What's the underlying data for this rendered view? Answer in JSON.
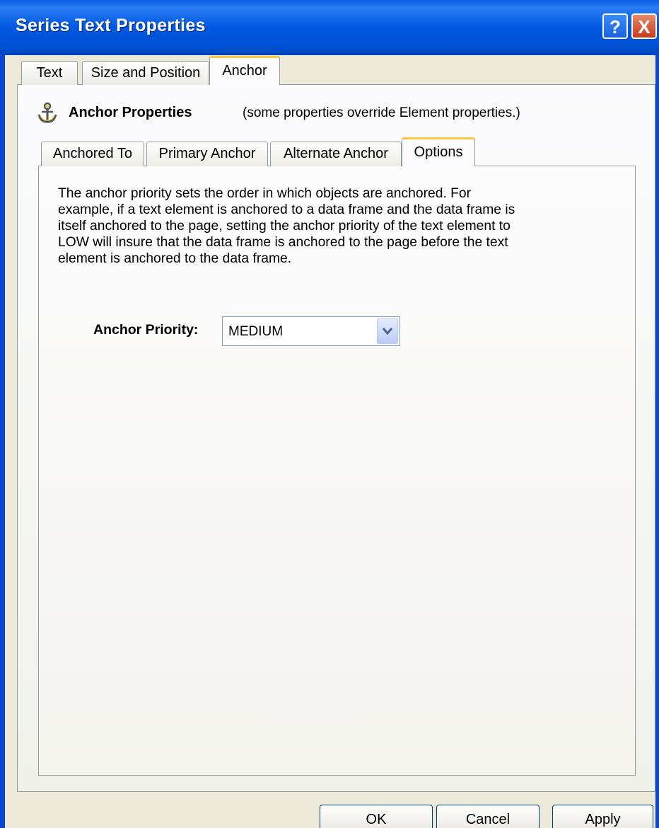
{
  "window": {
    "title": "Series Text Properties"
  },
  "title_buttons": {
    "help": "?",
    "close": "X"
  },
  "tabs": [
    {
      "label": "Text",
      "active": false
    },
    {
      "label": "Size and Position",
      "active": false
    },
    {
      "label": "Anchor",
      "active": true
    }
  ],
  "anchor_section": {
    "icon": "anchor-icon",
    "title": "Anchor Properties",
    "note": "(some properties override Element properties.)"
  },
  "subtabs": [
    {
      "label": "Anchored To",
      "active": false
    },
    {
      "label": "Primary Anchor",
      "active": false
    },
    {
      "label": "Alternate Anchor",
      "active": false
    },
    {
      "label": "Options",
      "active": true
    }
  ],
  "options": {
    "description_lines": [
      "The anchor priority sets the order in which objects are anchored.  For",
      "example, if a text element is anchored to a data frame and the data frame is",
      "itself anchored to the page, setting the anchor priority of the text element to",
      "LOW will insure that the data frame is anchored to the page before the text",
      "element is anchored to the data frame."
    ],
    "priority_label": "Anchor Priority:",
    "priority_value": "MEDIUM"
  },
  "buttons": {
    "ok": "OK",
    "cancel": "Cancel",
    "apply": "Apply"
  },
  "colors": {
    "titlebar": "#0058e0",
    "active_tab_accent": "#ffc83c",
    "dialog_bg": "#ece9d8"
  }
}
